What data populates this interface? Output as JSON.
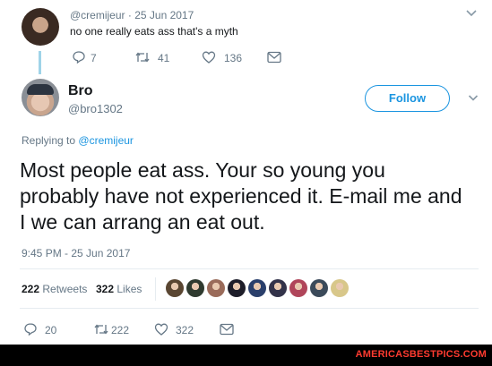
{
  "parent_tweet": {
    "handle": "@cremijeur",
    "separator": "·",
    "date": "25 Jun 2017",
    "text": "no one really eats ass that's a myth",
    "actions": {
      "replies": "7",
      "retweets": "41",
      "likes": "136"
    }
  },
  "reply_tweet": {
    "display_name": "Bro",
    "handle": "@bro1302",
    "follow_label": "Follow",
    "replying_prefix": "Replying to",
    "replying_handle": "@cremijeur",
    "text": "Most people eat ass. Your so young you probably have not experienced it. E-mail me and I we can arrang an eat out.",
    "timestamp": "9:45 PM - 25 Jun 2017",
    "stats": {
      "retweets_count": "222",
      "retweets_label": "Retweets",
      "likes_count": "322",
      "likes_label": "Likes"
    },
    "likers": [
      {
        "name": "liker-1",
        "color": "#5a4632"
      },
      {
        "name": "liker-2",
        "color": "#2f3a2f"
      },
      {
        "name": "liker-3",
        "color": "#9a6b5a"
      },
      {
        "name": "liker-4",
        "color": "#1e1e2a"
      },
      {
        "name": "liker-5",
        "color": "#2a3f6b"
      },
      {
        "name": "liker-6",
        "color": "#33334a"
      },
      {
        "name": "liker-7",
        "color": "#b0455a"
      },
      {
        "name": "liker-8",
        "color": "#3b4a5a"
      },
      {
        "name": "liker-9",
        "color": "#d8c78a"
      }
    ],
    "actions": {
      "replies": "20",
      "retweets": "222",
      "likes": "322"
    }
  },
  "watermark": "AMERICASBESTPICS.COM",
  "colors": {
    "link": "#1b95e0",
    "muted": "#657786",
    "text": "#14171a"
  }
}
